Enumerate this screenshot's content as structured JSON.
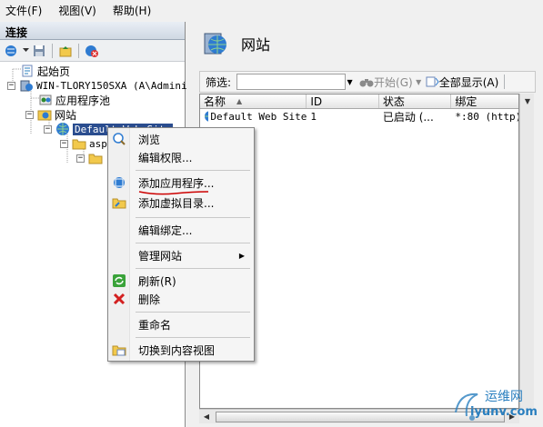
{
  "menubar": {
    "file": "文件(F)",
    "view": "视图(V)",
    "help": "帮助(H)"
  },
  "left": {
    "header": "连接",
    "tree": {
      "start_page": "起始页",
      "server": "WIN-TLORY150SXA (A\\Adminis",
      "app_pools": "应用程序池",
      "sites": "网站",
      "default_site": "Default Web Site",
      "asp_folder": "asp",
      "subfolder": ""
    }
  },
  "right": {
    "title": "网站",
    "filter": {
      "label": "筛选:",
      "input_value": "",
      "start": "开始(G)",
      "show_all": "全部显示(A)"
    },
    "columns": [
      "名称",
      "ID",
      "状态",
      "绑定"
    ],
    "rows": [
      {
        "name": "Default Web Site",
        "id": "1",
        "status": "已启动 (...",
        "binding": "*:80 (http)"
      }
    ]
  },
  "context_menu": {
    "items": {
      "browse": "浏览",
      "edit_permissions": "编辑权限...",
      "add_app": "添加应用程序...",
      "add_vdir": "添加虚拟目录...",
      "edit_bindings": "编辑绑定...",
      "manage_site": "管理网站",
      "refresh": "刷新(R)",
      "delete": "删除",
      "rename": "重命名",
      "switch_content_view": "切换到内容视图"
    }
  },
  "watermark": {
    "cn": "运维网",
    "url": "iyunv.com"
  },
  "colors": {
    "selection": "#2a4d8f",
    "underline_annotation": "#cc0000",
    "watermark": "#2a7fbf"
  }
}
